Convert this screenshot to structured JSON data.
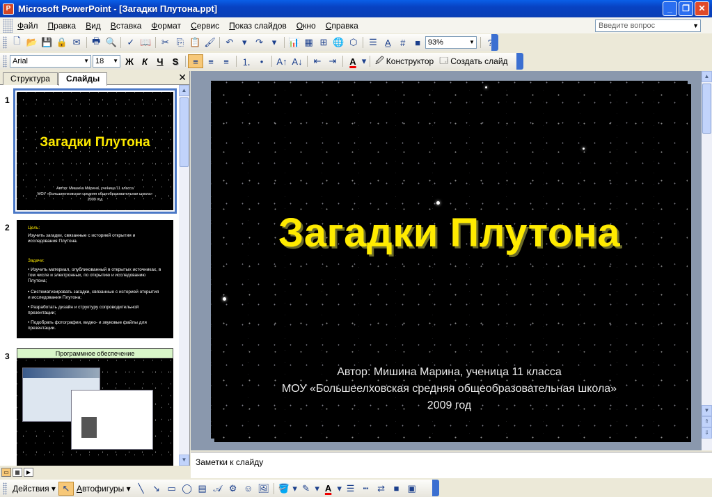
{
  "window": {
    "title": "Microsoft PowerPoint - [Загадки Плутона.ppt]",
    "controls": [
      "_",
      "❐",
      "✕"
    ]
  },
  "menu": {
    "items": [
      "Файл",
      "Правка",
      "Вид",
      "Вставка",
      "Формат",
      "Сервис",
      "Показ слайдов",
      "Окно",
      "Справка"
    ],
    "help_placeholder": "Введите вопрос"
  },
  "toolbar_standard": {
    "zoom": "93%"
  },
  "toolbar_format": {
    "font": "Arial",
    "size": "18",
    "bold": "Ж",
    "italic": "К",
    "underline": "Ч",
    "shadow": "S",
    "font_color_letter": "A",
    "designer_label": "Конструктор",
    "new_slide_label": "Создать слайд"
  },
  "panel": {
    "tab_outline": "Структура",
    "tab_slides": "Слайды",
    "close": "✕"
  },
  "thumbnails": [
    {
      "number": "1",
      "title": "Загадки Плутона",
      "lines": [
        "Автор: Мишина Марина, ученица 11 класса",
        "МОУ «Большеелховская средняя общеобразовательная школа»",
        "2009 год"
      ]
    },
    {
      "number": "2",
      "goal_head": "Цель:",
      "goal_text": "Изучить загадки, связанные с историей открытия и исследования Плутона.",
      "tasks_head": "Задачи:",
      "tasks": [
        "•  Изучить материал, опубликованный в открытых источниках, в том числе и электронных, по открытию и исследованию Плутона;",
        "•  Систематизировать загадки, связанные с историей открытия и исследования Плутона;",
        "•  Разработать дизайн и структуру сопроводительной презентации;",
        "•  Подобрать фотографии, видео- и звуковые файлы для презентации."
      ]
    },
    {
      "number": "3",
      "header": "Программное обеспечение"
    }
  ],
  "slide": {
    "title": "Загадки Плутона",
    "author": "Автор: Мишина Марина, ученица 11 класса",
    "school": "МОУ «Большеелховская средняя общеобразовательная школа»",
    "year": "2009 год"
  },
  "notes": {
    "placeholder": "Заметки к слайду"
  },
  "drawing_toolbar": {
    "actions": "Действия",
    "autoshapes": "Автофигуры"
  },
  "colors": {
    "title_yellow": "#ffeb00",
    "slide_bg": "#000000",
    "titlebar_blue": "#0a4fd8",
    "workspace": "#8a98ad"
  }
}
